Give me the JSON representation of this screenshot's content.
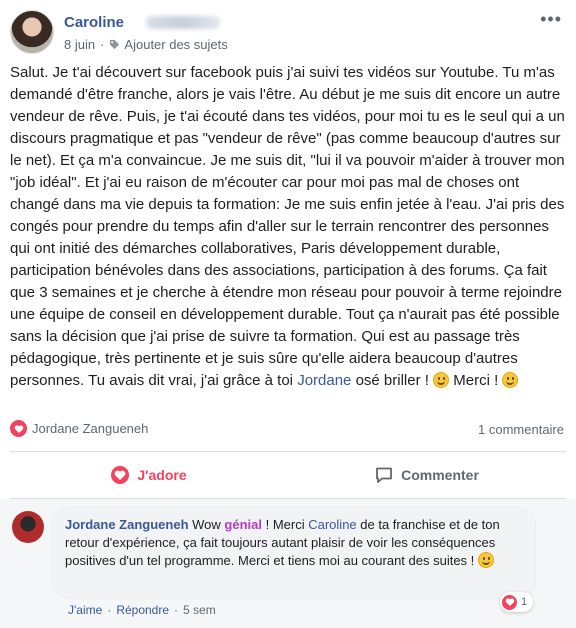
{
  "post": {
    "author_name": "Caroline",
    "date": "8 juin",
    "meta_separator": "·",
    "add_topics": "Ajouter des sujets",
    "more_menu": "•••",
    "body_part1": "Salut. Je t'ai découvert sur facebook puis j'ai suivi tes vidéos sur Youtube. Tu m'as demandé d'être franche, alors je vais l'être. Au début je me suis dit encore un autre vendeur de rêve. Puis, je t'ai écouté dans tes vidéos, pour moi tu es le seul qui a un discours pragmatique et pas \"vendeur de rêve\" (pas comme beaucoup d'autres sur le net). Et ça m'a convaincue. Je me suis dit, \"lui il va pouvoir m'aider à trouver mon \"job idéal\". Et j'ai eu raison de m'écouter car pour moi pas mal de choses ont changé dans ma vie depuis ta formation: Je me suis enfin jetée à l'eau. J'ai pris des congés pour prendre du temps afin d'aller sur le terrain rencontrer des personnes qui ont initié des démarches collaboratives, Paris développement durable, participation bénévoles dans des associations, participation à des forums. Ça fait que 3 semaines et je cherche à étendre mon réseau pour pouvoir à terme rejoindre une équipe de conseil en développement durable. Tout ça n'aurait pas été possible sans la décision que j'ai prise de suivre ta formation. Qui est au passage très pédagogique, très pertinente et je suis sûre qu'elle aidera beaucoup d'autres personnes. Tu avais dit vrai, j'ai grâce à toi ",
    "body_mention": "Jordane",
    "body_part2": " osé briller ! ",
    "body_part3": " Merci ! "
  },
  "reactions": {
    "reactor_name": "Jordane Zangueneh",
    "comment_count": "1 commentaire"
  },
  "actions": {
    "love_label": "J'adore",
    "comment_label": "Commenter"
  },
  "comment": {
    "author": "Jordane Zangueneh",
    "text_part1": " Wow ",
    "genial": "génial",
    "text_part2": " ! Merci ",
    "mention": "Caroline",
    "text_part3": " de ta franchise et de ton retour d'expérience, ça fait toujours autant plaisir de voir les conséquences positives d'un tel programme. Merci et tiens moi au courant des suites ! ",
    "reaction_count": "1",
    "like_label": "J'aime",
    "reply_label": "Répondre",
    "separator": "·",
    "time": "5 sem"
  },
  "colors": {
    "link_blue": "#385898",
    "love_red": "#f3425f",
    "genial_purple": "#b43ac7",
    "meta_gray": "#606770"
  }
}
